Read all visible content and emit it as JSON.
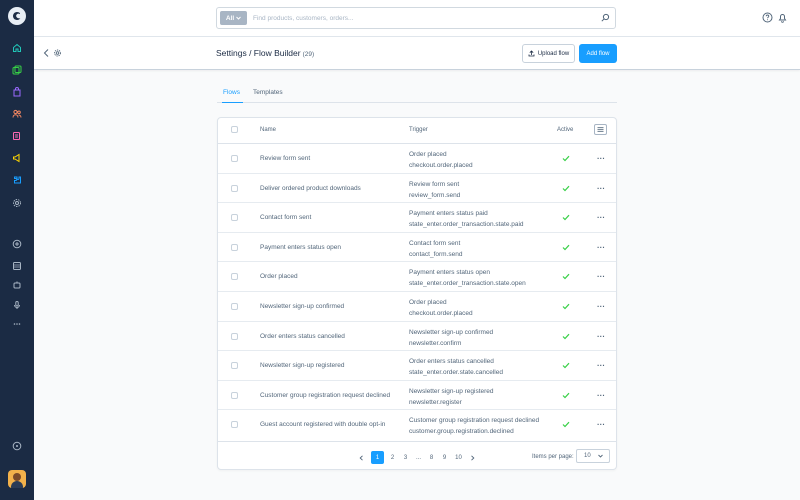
{
  "search": {
    "filter_label": "All",
    "placeholder": "Find products, customers, orders..."
  },
  "header": {
    "title": "Settings / Flow Builder",
    "count": "(29)",
    "upload_label": "Upload flow",
    "add_label": "Add flow"
  },
  "tabs": [
    {
      "label": "Flows"
    },
    {
      "label": "Templates"
    }
  ],
  "table": {
    "headers": {
      "name": "Name",
      "trigger": "Trigger",
      "active": "Active"
    },
    "rows": [
      {
        "name": "Review form sent",
        "trigger1": "Order placed",
        "trigger2": "checkout.order.placed",
        "active": true
      },
      {
        "name": "Deliver ordered product downloads",
        "trigger1": "Review form sent",
        "trigger2": "review_form.send",
        "active": true
      },
      {
        "name": "Contact form sent",
        "trigger1": "Payment enters status paid",
        "trigger2": "state_enter.order_transaction.state.paid",
        "active": true
      },
      {
        "name": "Payment enters status open",
        "trigger1": "Contact form sent",
        "trigger2": "contact_form.send",
        "active": true
      },
      {
        "name": "Order placed",
        "trigger1": "Payment enters status open",
        "trigger2": "state_enter.order_transaction.state.open",
        "active": true
      },
      {
        "name": "Newsletter sign-up confirmed",
        "trigger1": "Order placed",
        "trigger2": "checkout.order.placed",
        "active": true
      },
      {
        "name": "Order enters status cancelled",
        "trigger1": "Newsletter sign-up confirmed",
        "trigger2": "newsletter.confirm",
        "active": true
      },
      {
        "name": "Newsletter sign-up registered",
        "trigger1": "Order enters status cancelled",
        "trigger2": "state_enter.order.state.cancelled",
        "active": true
      },
      {
        "name": "Customer group registration request declined",
        "trigger1": "Newsletter sign-up registered",
        "trigger2": "newsletter.register",
        "active": true
      },
      {
        "name": "Guest account registered with double opt-in",
        "trigger1": "Customer group registration request declined",
        "trigger2": "customer.group.registration.declined",
        "active": true
      }
    ],
    "row_menu": "···"
  },
  "pagination": {
    "pages": [
      "1",
      "2",
      "3",
      "...",
      "8",
      "9",
      "10"
    ],
    "current": "1",
    "items_per_page_label": "Items per page:",
    "items_per_page_value": "10"
  },
  "colors": {
    "sidebar": "#1b2b44",
    "accent": "#189eff",
    "check": "#37d046"
  },
  "icons": {
    "sidebar": [
      "dashboard-icon",
      "catalogue-icon",
      "orders-icon",
      "customers-icon",
      "content-icon",
      "marketing-icon",
      "extensions-icon",
      "settings-icon",
      "sales-channels-add-icon",
      "storefront-icon",
      "headless-icon",
      "voice-icon",
      "more-icon",
      "help-icon"
    ]
  }
}
